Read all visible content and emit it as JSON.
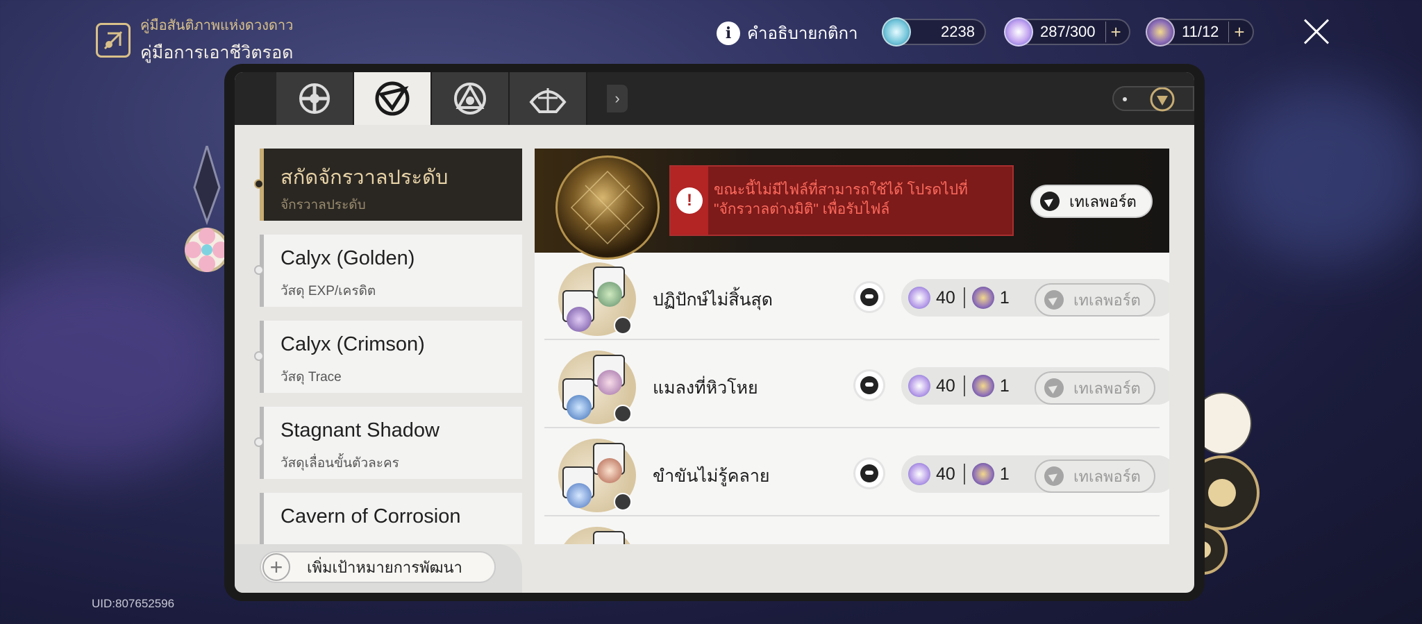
{
  "header": {
    "guide_subtitle": "คู่มือสันติภาพแห่งดวงดาว",
    "guide_title": "คู่มือการเอาชีวิตรอด",
    "info_label": "คำอธิบายกติกา",
    "currencies": [
      {
        "icon": "stellar-jade-icon",
        "value": "2238",
        "has_plus": false
      },
      {
        "icon": "trailblaze-power-icon",
        "value": "287/300",
        "has_plus": true
      },
      {
        "icon": "fuel-icon",
        "value": "11/12",
        "has_plus": true
      }
    ]
  },
  "tabs": [
    {
      "icon": "operation-briefing-icon",
      "active": false
    },
    {
      "icon": "daily-training-icon",
      "active": true
    },
    {
      "icon": "survival-index-icon",
      "active": false
    },
    {
      "icon": "treasures-icon",
      "active": false
    }
  ],
  "categories": [
    {
      "title": "สกัดจักรวาลประดับ",
      "subtitle": "จักรวาลประดับ",
      "active": true
    },
    {
      "title": "Calyx (Golden)",
      "subtitle": "วัสดุ EXP/เครดิต",
      "active": false
    },
    {
      "title": "Calyx (Crimson)",
      "subtitle": "วัสดุ Trace",
      "active": false
    },
    {
      "title": "Stagnant Shadow",
      "subtitle": "วัสดุเลื่อนขั้นตัวละคร",
      "active": false
    },
    {
      "title": "Cavern of Corrosion",
      "subtitle": "",
      "active": false
    }
  ],
  "add_goal_label": "เพิ่มเป้าหมายการพัฒนา",
  "banner": {
    "warning_line1": "ขณะนี้ไม่มีไฟล์ที่สามารถใช้ได้ โปรดไปที่",
    "warning_line2": "\"จักรวาลต่างมิติ\" เพื่อรับไฟล์",
    "teleport_label": "เทเลพอร์ต"
  },
  "rows": [
    {
      "name": "ปฏิปักษ์ไม่สิ้นสุด",
      "cost_power": "40",
      "cost_fuel": "1",
      "teleport": "เทเลพอร์ต"
    },
    {
      "name": "แมลงที่หิวโหย",
      "cost_power": "40",
      "cost_fuel": "1",
      "teleport": "เทเลพอร์ต"
    },
    {
      "name": "ขำขันไม่รู้คลาย",
      "cost_power": "40",
      "cost_fuel": "1",
      "teleport": "เทเลพอร์ต"
    }
  ],
  "uid": "UID:807652596",
  "colors": {
    "accent_gold": "#c8ad74",
    "warning_red": "#b32424",
    "warning_text": "#ff6b5d"
  }
}
